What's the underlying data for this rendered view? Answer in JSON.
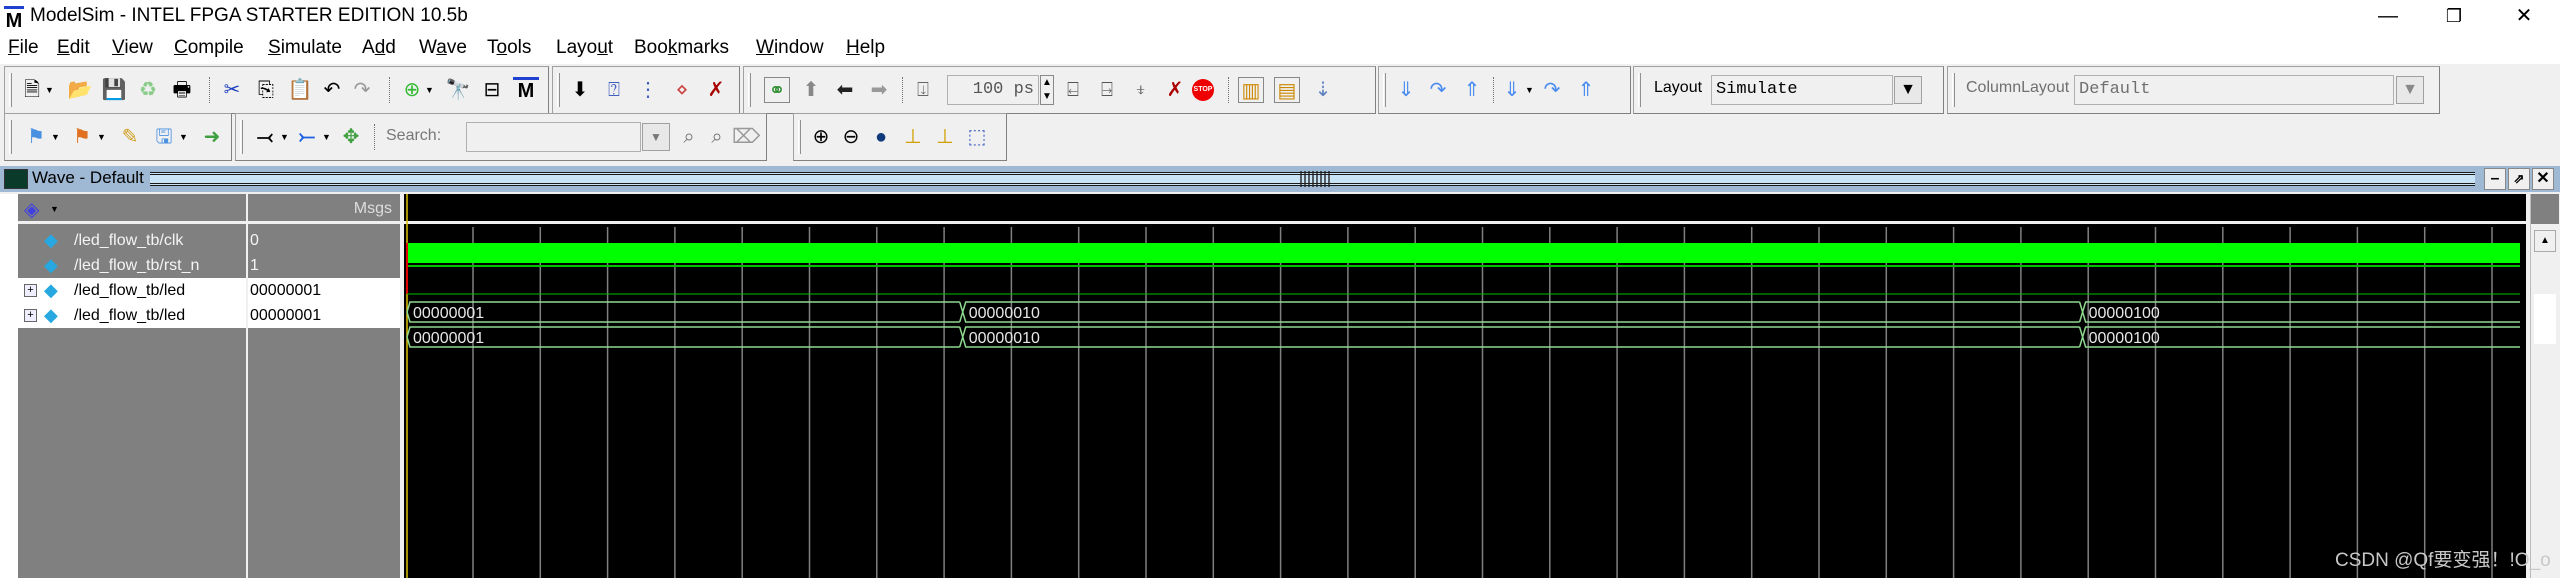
{
  "window": {
    "title": "ModelSim - INTEL FPGA STARTER EDITION 10.5b",
    "logo": "M",
    "controls": {
      "minimize": "—",
      "restore": "❐",
      "close": "✕"
    }
  },
  "menu": [
    {
      "label": "File",
      "u": "F",
      "rest": "ile"
    },
    {
      "label": "Edit",
      "u": "E",
      "rest": "dit"
    },
    {
      "label": "View",
      "u": "V",
      "rest": "iew"
    },
    {
      "label": "Compile",
      "u": "C",
      "rest": "ompile"
    },
    {
      "label": "Simulate",
      "u": "S",
      "rest": "imulate"
    },
    {
      "label": "Add",
      "pre": "A",
      "u": "d",
      "rest": "d"
    },
    {
      "label": "Wave",
      "pre": "W",
      "u": "a",
      "rest": "ve"
    },
    {
      "label": "Tools",
      "pre": "T",
      "u": "o",
      "rest": "ols"
    },
    {
      "label": "Layout",
      "pre": "Layo",
      "u": "u",
      "rest": "t"
    },
    {
      "label": "Bookmarks",
      "pre": "Boo",
      "u": "k",
      "rest": "marks"
    },
    {
      "label": "Window",
      "u": "W",
      "rest": "indow"
    },
    {
      "label": "Help",
      "u": "H",
      "rest": "elp"
    }
  ],
  "toolbar": {
    "run_length": "100 ps",
    "layout_label": "Layout",
    "layout_value": "Simulate",
    "column_layout_label": "ColumnLayout",
    "column_layout_value": "Default",
    "search_label": "Search:",
    "search_value": "",
    "stop_label": "STOP"
  },
  "wave_window": {
    "title": "Wave - Default",
    "msgs_header": "Msgs",
    "signals": [
      {
        "name": "/led_flow_tb/clk",
        "value": "0",
        "type": "bit",
        "expandable": false
      },
      {
        "name": "/led_flow_tb/rst_n",
        "value": "1",
        "type": "bit",
        "expandable": false
      },
      {
        "name": "/led_flow_tb/led",
        "value": "00000001",
        "type": "bus",
        "expandable": true
      },
      {
        "name": "/led_flow_tb/led",
        "value": "00000001",
        "type": "bus",
        "expandable": true
      }
    ],
    "bus_segments": [
      {
        "value": "00000001",
        "start_frac": 0.0
      },
      {
        "value": "00000010",
        "start_frac": 0.263
      },
      {
        "value": "00000100",
        "start_frac": 0.793
      }
    ],
    "grid_divisions": 20
  },
  "colors": {
    "wave_green": "#00ff00",
    "bus_line": "#8fd88f",
    "cursor": "#e0c000",
    "grid": "#808080",
    "header_blue": "#9fb8d3"
  },
  "watermark": "CSDN @Qf要变强！!O_o"
}
